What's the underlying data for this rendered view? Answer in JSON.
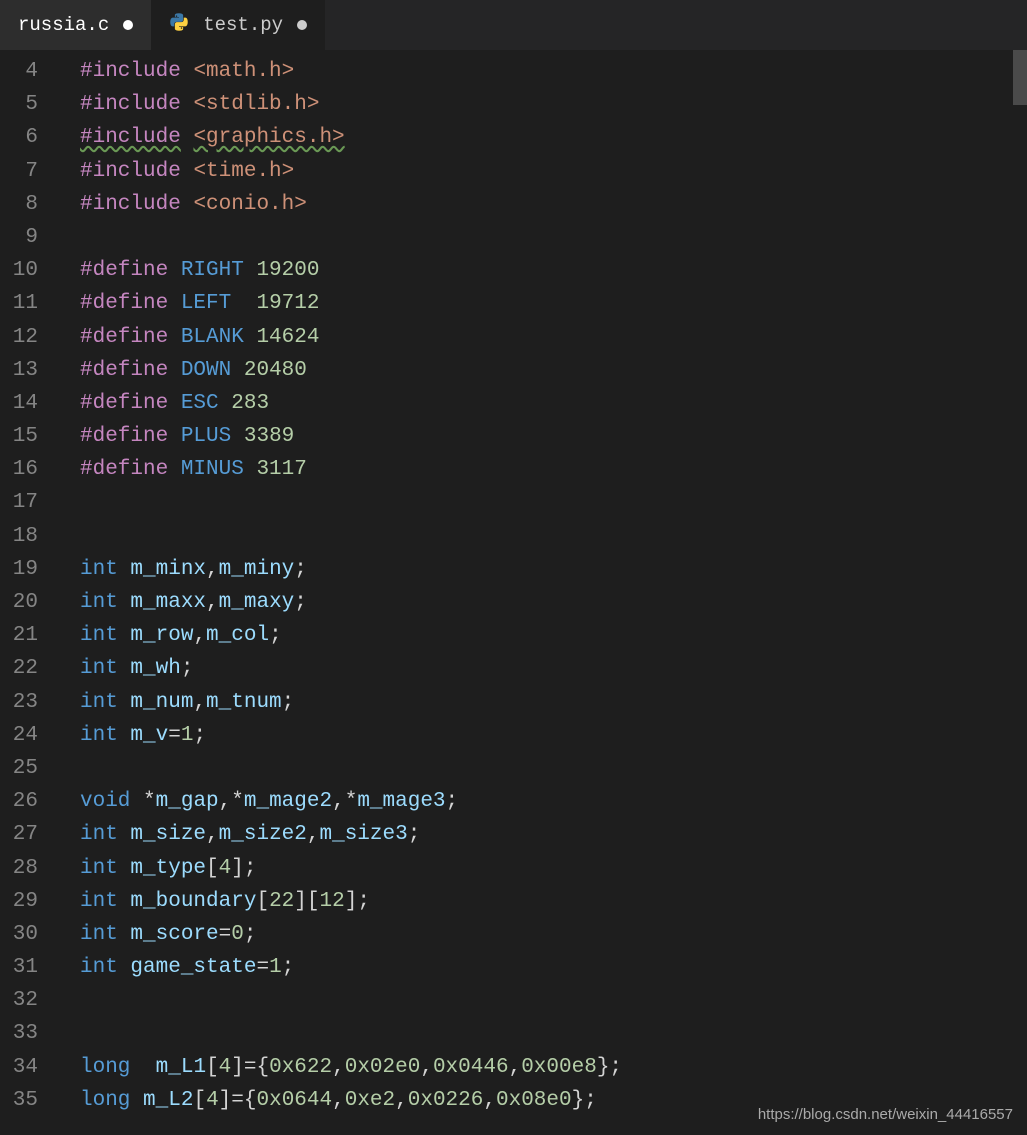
{
  "tabs": [
    {
      "label": "russia.c",
      "active": false,
      "dirty": true
    },
    {
      "label": "test.py",
      "active": true,
      "dirty": true,
      "icon": "python"
    }
  ],
  "watermark": "https://blog.csdn.net/weixin_44416557",
  "line_start": 4,
  "lines": [
    [
      {
        "cls": "c-pre",
        "t": "#include"
      },
      {
        "cls": "c-txt",
        "t": " "
      },
      {
        "cls": "c-inc",
        "t": "<math.h>"
      }
    ],
    [
      {
        "cls": "c-pre",
        "t": "#include"
      },
      {
        "cls": "c-txt",
        "t": " "
      },
      {
        "cls": "c-inc",
        "t": "<stdlib.h>"
      }
    ],
    [
      {
        "cls": "c-pre squiggle-green",
        "t": "#include"
      },
      {
        "cls": "c-txt",
        "t": " "
      },
      {
        "cls": "c-inc squiggle-green",
        "t": "<graphics.h>"
      }
    ],
    [
      {
        "cls": "c-pre",
        "t": "#include"
      },
      {
        "cls": "c-txt",
        "t": " "
      },
      {
        "cls": "c-inc",
        "t": "<time.h>"
      }
    ],
    [
      {
        "cls": "c-pre",
        "t": "#include"
      },
      {
        "cls": "c-txt",
        "t": " "
      },
      {
        "cls": "c-inc",
        "t": "<conio.h>"
      }
    ],
    [],
    [
      {
        "cls": "c-pre",
        "t": "#define"
      },
      {
        "cls": "c-txt",
        "t": " "
      },
      {
        "cls": "c-kw",
        "t": "RIGHT"
      },
      {
        "cls": "c-txt",
        "t": " "
      },
      {
        "cls": "c-num",
        "t": "19200"
      }
    ],
    [
      {
        "cls": "c-pre",
        "t": "#define"
      },
      {
        "cls": "c-txt",
        "t": " "
      },
      {
        "cls": "c-kw",
        "t": "LEFT"
      },
      {
        "cls": "c-txt",
        "t": "  "
      },
      {
        "cls": "c-num",
        "t": "19712"
      }
    ],
    [
      {
        "cls": "c-pre",
        "t": "#define"
      },
      {
        "cls": "c-txt",
        "t": " "
      },
      {
        "cls": "c-kw",
        "t": "BLANK"
      },
      {
        "cls": "c-txt",
        "t": " "
      },
      {
        "cls": "c-num",
        "t": "14624"
      }
    ],
    [
      {
        "cls": "c-pre",
        "t": "#define"
      },
      {
        "cls": "c-txt",
        "t": " "
      },
      {
        "cls": "c-kw",
        "t": "DOWN"
      },
      {
        "cls": "c-txt",
        "t": " "
      },
      {
        "cls": "c-num",
        "t": "20480"
      }
    ],
    [
      {
        "cls": "c-pre",
        "t": "#define"
      },
      {
        "cls": "c-txt",
        "t": " "
      },
      {
        "cls": "c-kw",
        "t": "ESC"
      },
      {
        "cls": "c-txt",
        "t": " "
      },
      {
        "cls": "c-num",
        "t": "283"
      }
    ],
    [
      {
        "cls": "c-pre",
        "t": "#define"
      },
      {
        "cls": "c-txt",
        "t": " "
      },
      {
        "cls": "c-kw",
        "t": "PLUS"
      },
      {
        "cls": "c-txt",
        "t": " "
      },
      {
        "cls": "c-num",
        "t": "3389"
      }
    ],
    [
      {
        "cls": "c-pre",
        "t": "#define"
      },
      {
        "cls": "c-txt",
        "t": " "
      },
      {
        "cls": "c-kw",
        "t": "MINUS"
      },
      {
        "cls": "c-txt",
        "t": " "
      },
      {
        "cls": "c-num",
        "t": "3117"
      }
    ],
    [],
    [],
    [
      {
        "cls": "c-kw",
        "t": "int"
      },
      {
        "cls": "c-txt",
        "t": " "
      },
      {
        "cls": "c-id",
        "t": "m_minx"
      },
      {
        "cls": "c-txt",
        "t": ","
      },
      {
        "cls": "c-id",
        "t": "m_miny"
      },
      {
        "cls": "c-txt",
        "t": ";"
      }
    ],
    [
      {
        "cls": "c-kw",
        "t": "int"
      },
      {
        "cls": "c-txt",
        "t": " "
      },
      {
        "cls": "c-id",
        "t": "m_maxx"
      },
      {
        "cls": "c-txt",
        "t": ","
      },
      {
        "cls": "c-id",
        "t": "m_maxy"
      },
      {
        "cls": "c-txt",
        "t": ";"
      }
    ],
    [
      {
        "cls": "c-kw",
        "t": "int"
      },
      {
        "cls": "c-txt",
        "t": " "
      },
      {
        "cls": "c-id",
        "t": "m_row"
      },
      {
        "cls": "c-txt",
        "t": ","
      },
      {
        "cls": "c-id",
        "t": "m_col"
      },
      {
        "cls": "c-txt",
        "t": ";"
      }
    ],
    [
      {
        "cls": "c-kw",
        "t": "int"
      },
      {
        "cls": "c-txt",
        "t": " "
      },
      {
        "cls": "c-id",
        "t": "m_wh"
      },
      {
        "cls": "c-txt",
        "t": ";"
      }
    ],
    [
      {
        "cls": "c-kw",
        "t": "int"
      },
      {
        "cls": "c-txt",
        "t": " "
      },
      {
        "cls": "c-id",
        "t": "m_num"
      },
      {
        "cls": "c-txt",
        "t": ","
      },
      {
        "cls": "c-id",
        "t": "m_tnum"
      },
      {
        "cls": "c-txt",
        "t": ";"
      }
    ],
    [
      {
        "cls": "c-kw",
        "t": "int"
      },
      {
        "cls": "c-txt",
        "t": " "
      },
      {
        "cls": "c-id",
        "t": "m_v"
      },
      {
        "cls": "c-txt",
        "t": "="
      },
      {
        "cls": "c-num",
        "t": "1"
      },
      {
        "cls": "c-txt",
        "t": ";"
      }
    ],
    [],
    [
      {
        "cls": "c-kw",
        "t": "void"
      },
      {
        "cls": "c-txt",
        "t": " *"
      },
      {
        "cls": "c-id",
        "t": "m_gap"
      },
      {
        "cls": "c-txt",
        "t": ",*"
      },
      {
        "cls": "c-id",
        "t": "m_mage2"
      },
      {
        "cls": "c-txt",
        "t": ",*"
      },
      {
        "cls": "c-id",
        "t": "m_mage3"
      },
      {
        "cls": "c-txt",
        "t": ";"
      }
    ],
    [
      {
        "cls": "c-kw",
        "t": "int"
      },
      {
        "cls": "c-txt",
        "t": " "
      },
      {
        "cls": "c-id",
        "t": "m_size"
      },
      {
        "cls": "c-txt",
        "t": ","
      },
      {
        "cls": "c-id",
        "t": "m_size2"
      },
      {
        "cls": "c-txt",
        "t": ","
      },
      {
        "cls": "c-id",
        "t": "m_size3"
      },
      {
        "cls": "c-txt",
        "t": ";"
      }
    ],
    [
      {
        "cls": "c-kw",
        "t": "int"
      },
      {
        "cls": "c-txt",
        "t": " "
      },
      {
        "cls": "c-id",
        "t": "m_type"
      },
      {
        "cls": "c-txt",
        "t": "["
      },
      {
        "cls": "c-num",
        "t": "4"
      },
      {
        "cls": "c-txt",
        "t": "];"
      }
    ],
    [
      {
        "cls": "c-kw",
        "t": "int"
      },
      {
        "cls": "c-txt",
        "t": " "
      },
      {
        "cls": "c-id",
        "t": "m_boundary"
      },
      {
        "cls": "c-txt",
        "t": "["
      },
      {
        "cls": "c-num",
        "t": "22"
      },
      {
        "cls": "c-txt",
        "t": "]["
      },
      {
        "cls": "c-num",
        "t": "12"
      },
      {
        "cls": "c-txt",
        "t": "];"
      }
    ],
    [
      {
        "cls": "c-kw",
        "t": "int"
      },
      {
        "cls": "c-txt",
        "t": " "
      },
      {
        "cls": "c-id",
        "t": "m_score"
      },
      {
        "cls": "c-txt",
        "t": "="
      },
      {
        "cls": "c-num",
        "t": "0"
      },
      {
        "cls": "c-txt",
        "t": ";"
      }
    ],
    [
      {
        "cls": "c-kw",
        "t": "int"
      },
      {
        "cls": "c-txt",
        "t": " "
      },
      {
        "cls": "c-id",
        "t": "game_state"
      },
      {
        "cls": "c-txt",
        "t": "="
      },
      {
        "cls": "c-num",
        "t": "1"
      },
      {
        "cls": "c-txt",
        "t": ";"
      }
    ],
    [],
    [],
    [
      {
        "cls": "c-kw",
        "t": "long"
      },
      {
        "cls": "c-txt",
        "t": "  "
      },
      {
        "cls": "c-id",
        "t": "m_L1"
      },
      {
        "cls": "c-txt",
        "t": "["
      },
      {
        "cls": "c-num",
        "t": "4"
      },
      {
        "cls": "c-txt",
        "t": "]={"
      },
      {
        "cls": "c-num",
        "t": "0x622"
      },
      {
        "cls": "c-txt",
        "t": ","
      },
      {
        "cls": "c-num",
        "t": "0x02e0"
      },
      {
        "cls": "c-txt",
        "t": ","
      },
      {
        "cls": "c-num",
        "t": "0x0446"
      },
      {
        "cls": "c-txt",
        "t": ","
      },
      {
        "cls": "c-num",
        "t": "0x00e8"
      },
      {
        "cls": "c-txt",
        "t": "};"
      }
    ],
    [
      {
        "cls": "c-kw",
        "t": "long"
      },
      {
        "cls": "c-txt",
        "t": " "
      },
      {
        "cls": "c-id",
        "t": "m_L2"
      },
      {
        "cls": "c-txt",
        "t": "["
      },
      {
        "cls": "c-num",
        "t": "4"
      },
      {
        "cls": "c-txt",
        "t": "]={"
      },
      {
        "cls": "c-num",
        "t": "0x0644"
      },
      {
        "cls": "c-txt",
        "t": ","
      },
      {
        "cls": "c-num",
        "t": "0xe2"
      },
      {
        "cls": "c-txt",
        "t": ","
      },
      {
        "cls": "c-num",
        "t": "0x0226"
      },
      {
        "cls": "c-txt",
        "t": ","
      },
      {
        "cls": "c-num",
        "t": "0x08e0"
      },
      {
        "cls": "c-txt",
        "t": "};"
      }
    ]
  ]
}
